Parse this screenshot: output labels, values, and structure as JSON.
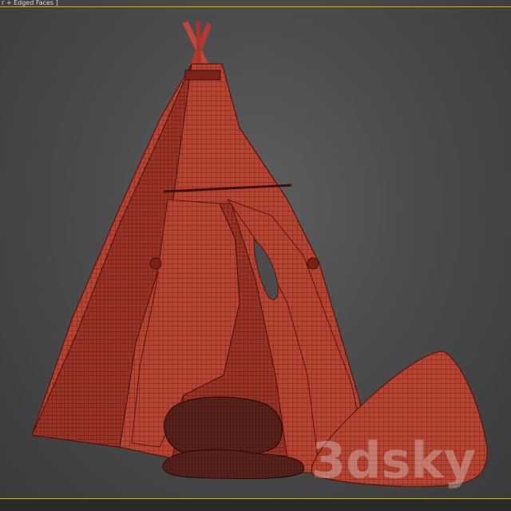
{
  "viewport": {
    "label": "r + Edged Faces ]",
    "background_color": "#4b4b4b",
    "frame_color": "#bfae3b"
  },
  "model": {
    "wire_color": "#b43a2c",
    "shade_color": "#8e2a20",
    "pillow_color": "#4a1c16"
  },
  "watermark": {
    "text": "3dsky"
  }
}
